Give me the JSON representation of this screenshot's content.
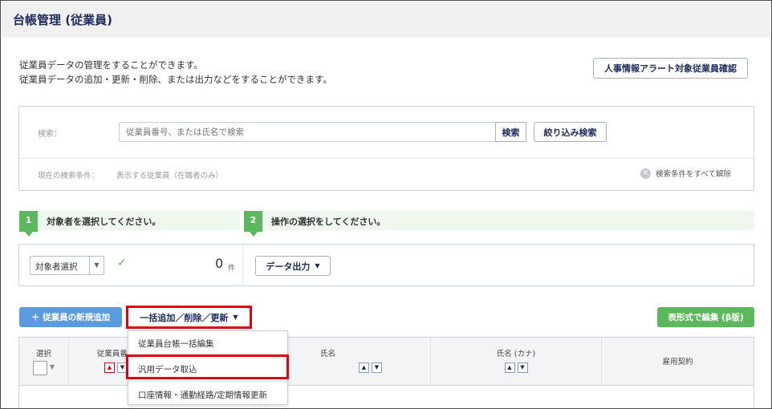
{
  "page": {
    "title": "台帳管理 (従業員)"
  },
  "description": {
    "line1": "従業員データの管理をすることができます。",
    "line2": "従業員データの追加・更新・削除、または出力などをすることができます。"
  },
  "alert_button": "人事情報アラート対象従業員確認",
  "search": {
    "label": "検索：",
    "placeholder": "従業員番号、または氏名で検索",
    "search_button": "検索",
    "filter_button": "絞り込み検索",
    "condition_label": "現在の検索条件：",
    "condition_value": "表示する従業員（在職者のみ）",
    "clear_label": "検索条件をすべて解除",
    "clear_icon": "x-circle-icon"
  },
  "steps": [
    {
      "number": "1",
      "text": "対象者を選択してください。"
    },
    {
      "number": "2",
      "text": "操作の選択をしてください。"
    }
  ],
  "selection": {
    "select_label": "対象者選択",
    "check_icon": "check-icon",
    "count": "0",
    "count_unit": "件",
    "data_output_label": "データ出力"
  },
  "actions": {
    "add_employee_label": "＋ 従業員の新規追加",
    "bulk_label": "一括追加／削除／更新",
    "table_edit_label": "表形式で編集 (β版)"
  },
  "dropdown": {
    "items": [
      "従業員台帳一括編集",
      "汎用データ取込",
      "口座情報・通勤経路/定期情報更新"
    ]
  },
  "table": {
    "headers": {
      "select": "選択",
      "employee_number": "従業員番号",
      "name": "氏名",
      "name_kana": "氏名 (カナ)",
      "employment_contract": "雇用契約"
    }
  },
  "colors": {
    "title": "#1e2a5a",
    "step_green": "#5cb85c",
    "highlight_red": "#e00012",
    "add_button_blue": "#5a9be0"
  }
}
